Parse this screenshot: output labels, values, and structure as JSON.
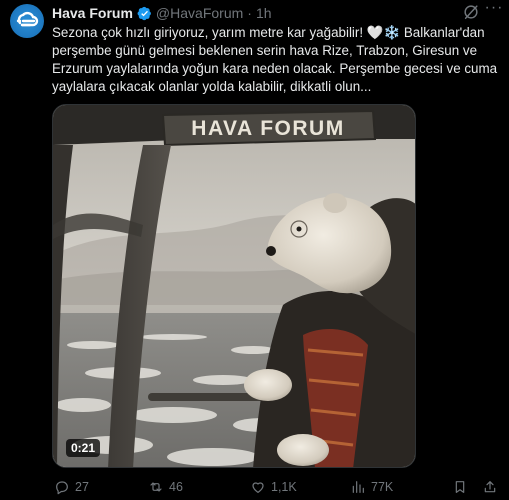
{
  "author": {
    "name": "Hava Forum",
    "handle": "@HavaForum",
    "separator": "·",
    "time": "1h"
  },
  "tweet": {
    "line1": "Sezona çok hızlı giriyoruz, yarım metre kar yağabilir! 🤍❄️ Balkanlar'dan",
    "line2": "perşembe günü gelmesi beklenen serin hava Rize, Trabzon, Giresun ve",
    "line3": "Erzurum yaylalarında yoğun kara neden olacak. Perşembe gecesi ve cuma",
    "line4": "yaylalara çıkacak olanlar yolda kalabilir, dikkatli olun..."
  },
  "media": {
    "sign_text": "HAVA FORUM",
    "duration": "0:21"
  },
  "actions": {
    "replies": "27",
    "reposts": "46",
    "likes": "1,1K",
    "views": "77K"
  },
  "colors": {
    "background": "#000000",
    "text": "#e7e9ea",
    "muted": "#71767b",
    "verified": "#1d9bf0",
    "avatar": "#1f7bc4"
  }
}
